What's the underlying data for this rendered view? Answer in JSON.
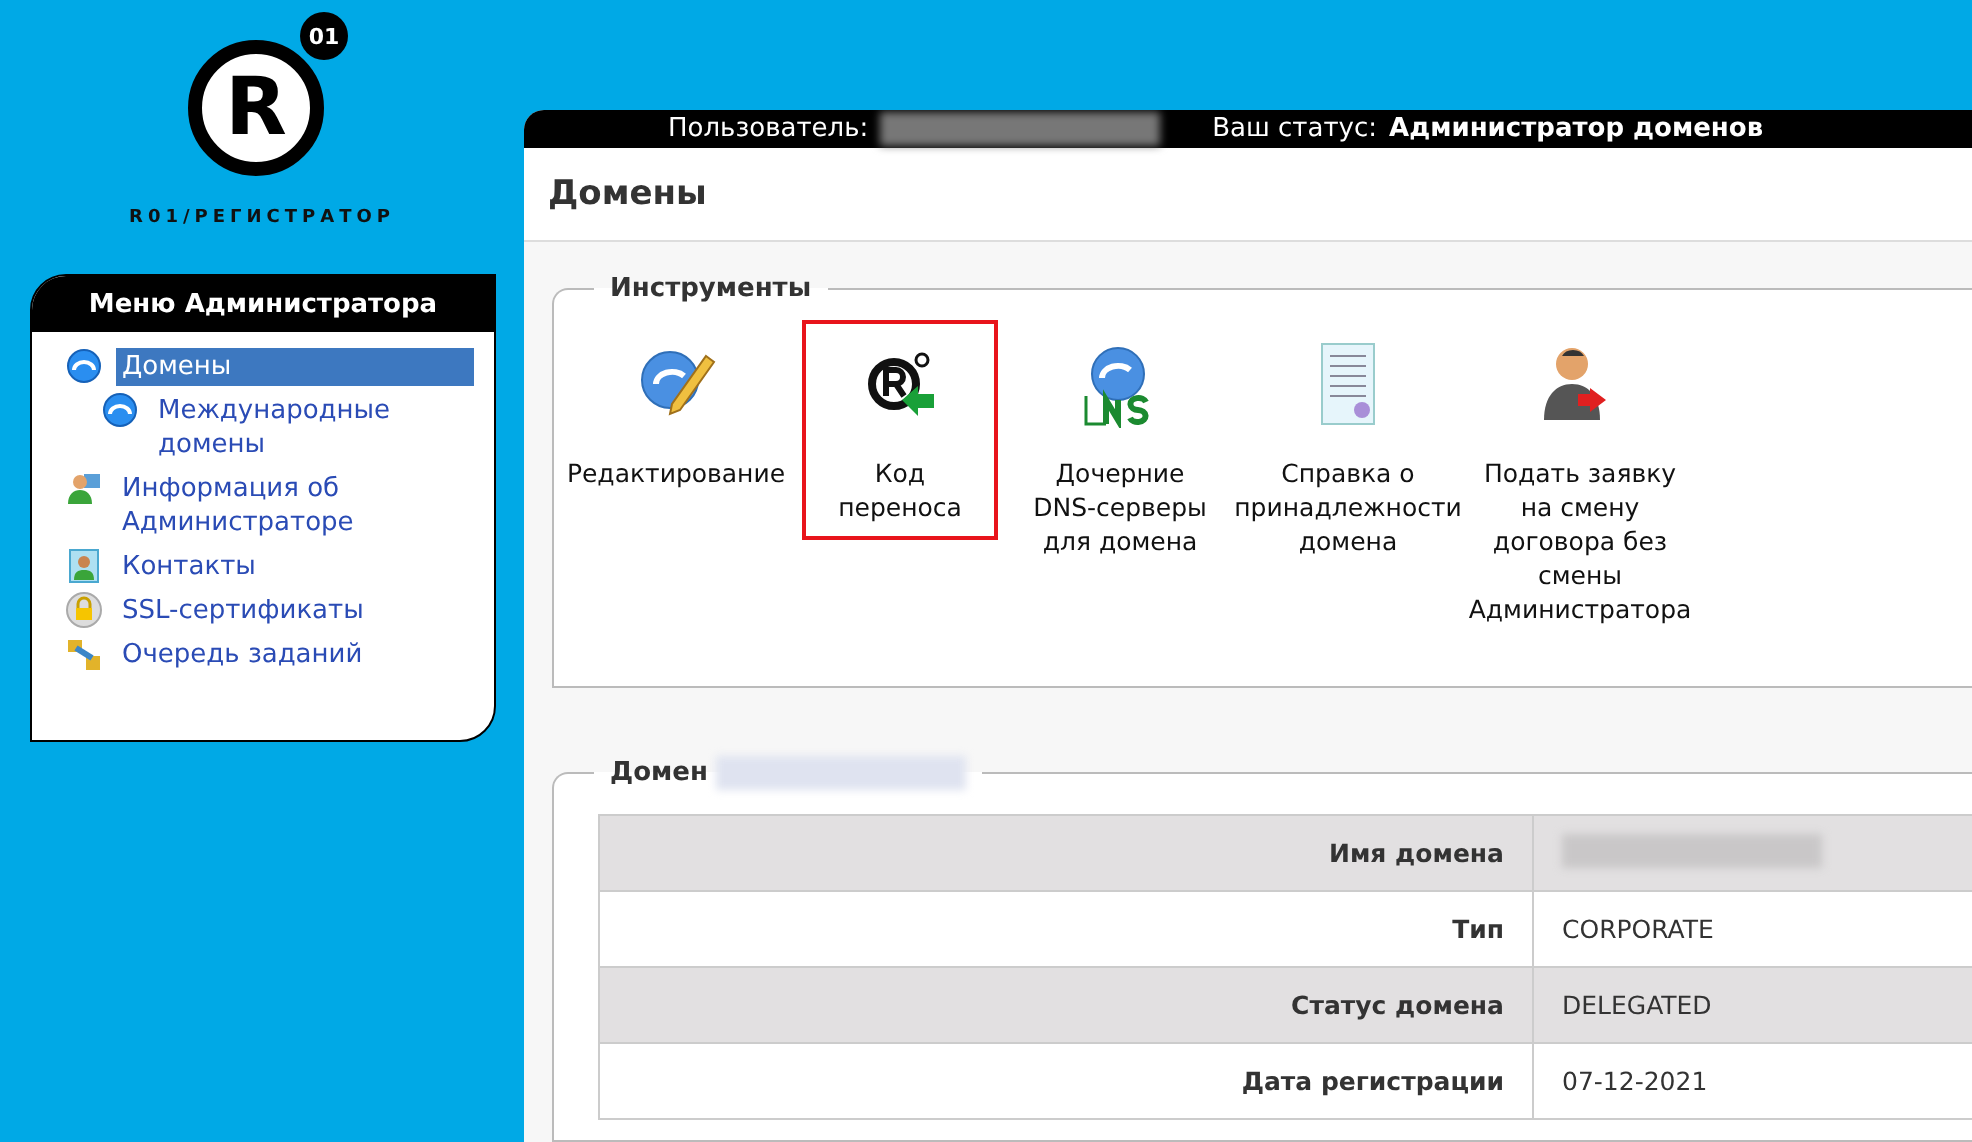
{
  "logo": {
    "letter": "R",
    "badge": "01",
    "wordmark": "R01/РЕГИСТРАТОР"
  },
  "user_bar": {
    "user_label": "Пользователь:",
    "user_redacted": true,
    "status_label": "Ваш статус:",
    "status_value": "Администратор доменов"
  },
  "menu": {
    "title": "Меню Администратора",
    "items": [
      {
        "label": "Домены",
        "kind": "globe",
        "selected": true,
        "children": [
          {
            "label": "Международные домены",
            "kind": "globe",
            "selected": false
          }
        ]
      },
      {
        "label": "Информация об Администраторе",
        "kind": "admin",
        "selected": false
      },
      {
        "label": "Контакты",
        "kind": "contact",
        "selected": false
      },
      {
        "label": "SSL-сертификаты",
        "kind": "lock",
        "selected": false
      },
      {
        "label": "Очередь заданий",
        "kind": "queue",
        "selected": false
      }
    ]
  },
  "page_title": "Домены",
  "tools": {
    "legend": "Инструменты",
    "items": [
      {
        "label": "Редактирование",
        "kind": "edit",
        "highlighted": false
      },
      {
        "label": "Код переноса",
        "kind": "transfer",
        "highlighted": true
      },
      {
        "label": "Дочерние DNS-серверы для домена",
        "kind": "dns",
        "highlighted": false
      },
      {
        "label": "Справка о принадлежности домена",
        "kind": "certificate",
        "highlighted": false
      },
      {
        "label": "Подать заявку на смену договора без смены Администратора",
        "kind": "person",
        "highlighted": false
      }
    ]
  },
  "domain": {
    "legend": "Домен",
    "name_redacted": true,
    "rows": [
      {
        "label": "Имя домена",
        "value_redacted": true
      },
      {
        "label": "Тип",
        "value": "CORPORATE"
      },
      {
        "label": "Статус домена",
        "value": "DELEGATED"
      },
      {
        "label": "Дата регистрации",
        "value": "07-12-2021"
      }
    ]
  }
}
